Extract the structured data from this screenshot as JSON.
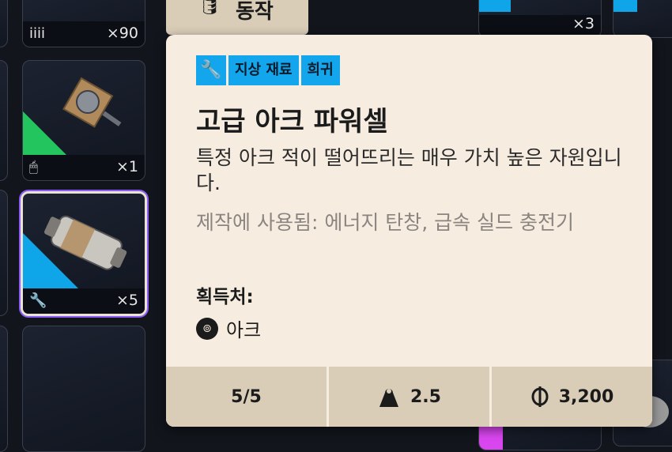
{
  "grid": {
    "top_left_qty": "×90",
    "top_left_cat_icon": "stack-icon",
    "top_left_cat": "iiii",
    "left_item_qty": "×1",
    "left_item_cat": "🖱",
    "selected_qty": "×5",
    "selected_cat": "🔧",
    "right_top_qty": "×3"
  },
  "tab": {
    "icon": "🛢",
    "label": "동작"
  },
  "tooltip": {
    "tag_icon": "🔧",
    "tags": [
      "지상 재료",
      "희귀"
    ],
    "title": "고급 아크 파워셀",
    "description": "특정 아크 적이 떨어뜨리는 매우 가치 높은 자원입니다.",
    "used_in": "제작에 사용됨: 에너지 탄창, 급속 실드 충전기",
    "source_heading": "획득처:",
    "source_icon": "⊚",
    "source": "아크",
    "stats": {
      "stack": "5/5",
      "weight_icon": "⚖",
      "weight": "2.5",
      "value_icon": "₵",
      "value": "3,200"
    }
  },
  "colors": {
    "tag_blue": "#13a6ec",
    "card_bg": "#f7ece0",
    "stat_bg": "#d9cdb8",
    "rarity_green": "#22c55e",
    "rarity_blue": "#0ea5e9",
    "selected_outline": "#8b5cf6"
  }
}
